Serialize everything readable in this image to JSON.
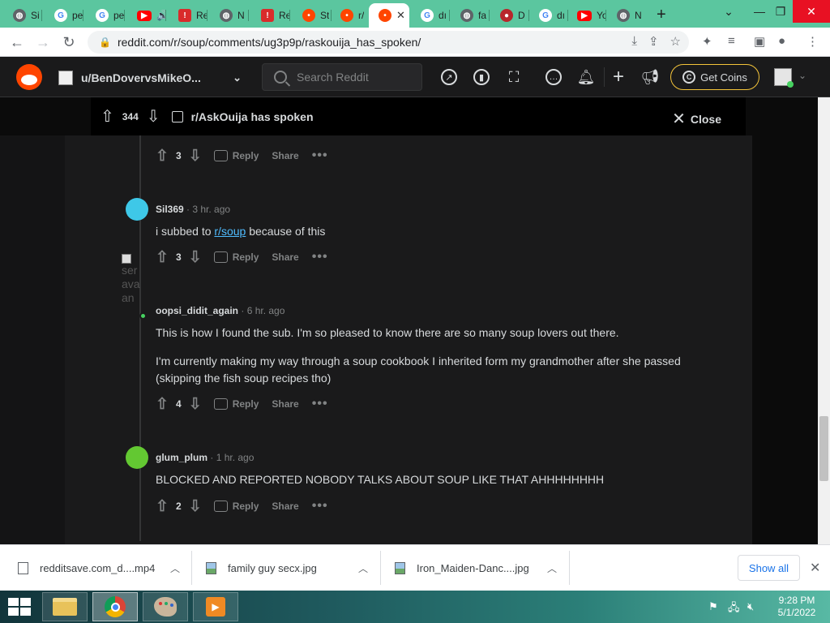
{
  "browser": {
    "tabs": [
      {
        "title": "Si",
        "icon": "globe-icon"
      },
      {
        "title": "pe",
        "icon": "google-icon"
      },
      {
        "title": "pe",
        "icon": "google-icon"
      },
      {
        "title": "",
        "icon": "youtube-icon"
      },
      {
        "title": "Re",
        "icon": "reddit-red-icon"
      },
      {
        "title": "N",
        "icon": "globe-icon"
      },
      {
        "title": "Re",
        "icon": "reddit-red-icon"
      },
      {
        "title": "St",
        "icon": "reddit-icon"
      },
      {
        "title": "r/",
        "icon": "reddit-icon"
      },
      {
        "title": "",
        "icon": "reddit-icon",
        "active": true
      },
      {
        "title": "dı",
        "icon": "google-icon"
      },
      {
        "title": "fa",
        "icon": "globe-icon"
      },
      {
        "title": "D",
        "icon": "dd-icon"
      },
      {
        "title": "dı",
        "icon": "google-icon"
      },
      {
        "title": "Yo",
        "icon": "youtube-icon"
      },
      {
        "title": "N",
        "icon": "globe-icon"
      }
    ],
    "url": "reddit.com/r/soup/comments/ug3p9p/raskouija_has_spoken/"
  },
  "reddit_header": {
    "username": "u/BenDovervsMikeO...",
    "search_placeholder": "Search Reddit",
    "coins_label": "Get Coins"
  },
  "post_bar": {
    "score": "344",
    "title": "r/AskOuija has spoken",
    "close_label": "Close"
  },
  "comments": [
    {
      "score": "3",
      "reply": "Reply",
      "share": "Share"
    },
    {
      "user": "Sil369",
      "time": "· 3 hr. ago",
      "body_prefix": "i subbed to ",
      "body_link": "r/soup",
      "body_suffix": " because of this",
      "score": "3",
      "reply": "Reply",
      "share": "Share"
    },
    {
      "user": "oopsi_didit_again",
      "time": "· 6 hr. ago",
      "body_p1": "This is how I found the sub. I'm so pleased to know there are so many soup lovers out there.",
      "body_p2": "I'm currently making my way through a soup cookbook I inherited form my grandmother after she passed (skipping the fish soup recipes tho)",
      "score": "4",
      "reply": "Reply",
      "share": "Share"
    },
    {
      "user": "glum_plum",
      "time": "· 1 hr. ago",
      "body": "BLOCKED AND REPORTED NOBODY TALKS ABOUT SOUP LIKE THAT AHHHHHHHH",
      "score": "2",
      "reply": "Reply",
      "share": "Share"
    }
  ],
  "broken_avatar_alt": "ser ava an",
  "downloads": {
    "items": [
      {
        "name": "redditsave.com_d....mp4",
        "type": "video-file-icon"
      },
      {
        "name": "family guy secx.jpg",
        "type": "image-file-icon"
      },
      {
        "name": "Iron_Maiden-Danc....jpg",
        "type": "image-file-icon"
      }
    ],
    "show_all": "Show all"
  },
  "taskbar": {
    "time": "9:28 PM",
    "date": "5/1/2022"
  },
  "colors": {
    "tabstrip": "#5bc69f",
    "reddit_orange": "#ff4500",
    "link": "#4fbcff",
    "coins_border": "#f4c43a"
  }
}
